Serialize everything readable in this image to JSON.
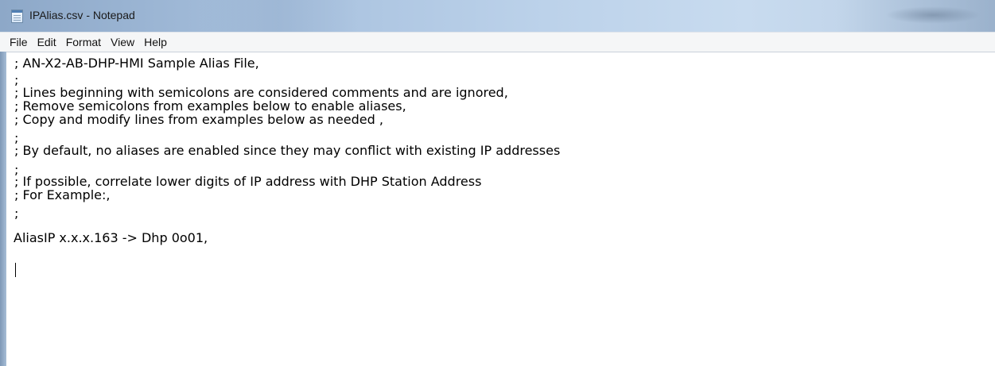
{
  "window": {
    "title": "IPAlias.csv - Notepad"
  },
  "menu": {
    "items": [
      "File",
      "Edit",
      "Format",
      "View",
      "Help"
    ]
  },
  "editor": {
    "lines": [
      "; AN-X2-AB-DHP-HMI Sample Alias File,",
      ";",
      "; Lines beginning with semicolons are considered comments and are ignored,",
      "; Remove semicolons from examples below to enable aliases,",
      "; Copy and modify lines from examples below as needed ,",
      ";",
      "; By default, no aliases are enabled since they may conflict with existing IP addresses",
      ";",
      "; If possible, correlate lower digits of IP address with DHP Station Address",
      "; For Example:,",
      ";",
      "AliasIP x.x.x.163 -> Dhp 0o01,"
    ]
  }
}
